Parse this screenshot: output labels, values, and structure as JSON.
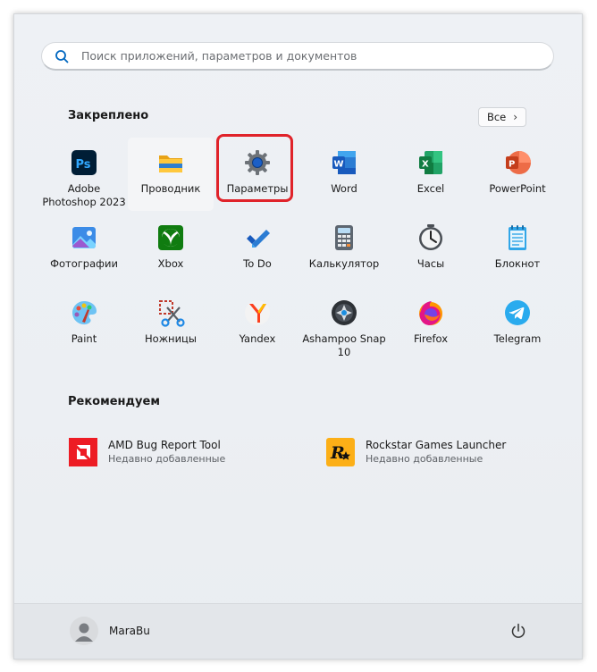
{
  "search": {
    "placeholder": "Поиск приложений, параметров и документов"
  },
  "pinned": {
    "title": "Закреплено",
    "all_label": "Все",
    "apps": [
      {
        "label": "Adobe Photoshop 2023",
        "icon": "photoshop-icon"
      },
      {
        "label": "Проводник",
        "icon": "file-explorer-icon"
      },
      {
        "label": "Параметры",
        "icon": "settings-gear-icon"
      },
      {
        "label": "Word",
        "icon": "word-icon"
      },
      {
        "label": "Excel",
        "icon": "excel-icon"
      },
      {
        "label": "PowerPoint",
        "icon": "powerpoint-icon"
      },
      {
        "label": "Фотографии",
        "icon": "photos-icon"
      },
      {
        "label": "Xbox",
        "icon": "xbox-icon"
      },
      {
        "label": "To Do",
        "icon": "todo-check-icon"
      },
      {
        "label": "Калькулятор",
        "icon": "calculator-icon"
      },
      {
        "label": "Часы",
        "icon": "clock-icon"
      },
      {
        "label": "Блокнот",
        "icon": "notepad-icon"
      },
      {
        "label": "Paint",
        "icon": "paint-palette-icon"
      },
      {
        "label": "Ножницы",
        "icon": "snipping-scissors-icon"
      },
      {
        "label": "Yandex",
        "icon": "yandex-browser-icon"
      },
      {
        "label": "Ashampoo Snap 10",
        "icon": "ashampoo-snap-icon"
      },
      {
        "label": "Firefox",
        "icon": "firefox-icon"
      },
      {
        "label": "Telegram",
        "icon": "telegram-icon"
      }
    ]
  },
  "recommended": {
    "title": "Рекомендуем",
    "items": [
      {
        "title": "AMD Bug Report Tool",
        "subtitle": "Недавно добавленные",
        "icon": "amd-icon"
      },
      {
        "title": "Rockstar Games Launcher",
        "subtitle": "Недавно добавленные",
        "icon": "rockstar-icon"
      }
    ]
  },
  "user": {
    "name": "MaraBu"
  },
  "colors": {
    "highlight": "#e0232a",
    "accent": "#0067c0"
  }
}
